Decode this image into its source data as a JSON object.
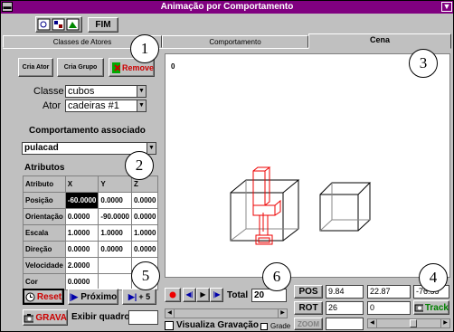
{
  "window": {
    "title": "Animação por Comportamento"
  },
  "toolbar": {
    "fim_label": "FIM"
  },
  "tabs": [
    {
      "label": "Classes de Atores"
    },
    {
      "label": "Comportamento"
    },
    {
      "label": "Cena"
    }
  ],
  "left": {
    "cria_ator": "Cria Ator",
    "cria_grupo": "Cria Grupo",
    "remove": "Remove",
    "classe_label": "Classe",
    "classe_value": "cubos",
    "ator_label": "Ator",
    "ator_value": "cadeiras #1",
    "comportamento_label": "Comportamento associado",
    "comportamento_value": "pulacad",
    "atributos_label": "Atributos"
  },
  "attr_table": {
    "headers": [
      "Atributo",
      "X",
      "Y",
      "Z"
    ],
    "rows": [
      [
        "Posição",
        "-60.0000",
        "0.0000",
        "0.0000"
      ],
      [
        "Orientação",
        "0.0000",
        "-90.0000",
        "0.0000"
      ],
      [
        "Escala",
        "1.0000",
        "1.0000",
        "1.0000"
      ],
      [
        "Direção",
        "0.0000",
        "0.0000",
        "0.0000"
      ],
      [
        "Velocidade",
        "2.0000",
        "",
        ""
      ],
      [
        "Cor",
        "0.0000",
        "",
        ""
      ]
    ]
  },
  "controls": {
    "reset": "Reset",
    "proximo": "Próximo",
    "plus5": "+ 5",
    "grava": "GRAVA",
    "exibir_label": "Exibir quadro:",
    "exibir_value": ""
  },
  "scene": {
    "frame_label": "0"
  },
  "playback": {
    "total_label": "Total",
    "total_value": "20",
    "visualiza": "Visualiza Gravação",
    "grade": "Grade"
  },
  "camera": {
    "pos_label": "POS",
    "pos_values": [
      "9.84",
      "22.87",
      "-76.55"
    ],
    "rot_label": "ROT",
    "rot_values": [
      "26",
      "0",
      "0"
    ],
    "track": "Track",
    "zoom": "ZOOM"
  },
  "callouts": [
    "1",
    "2",
    "3",
    "4",
    "5",
    "6"
  ]
}
